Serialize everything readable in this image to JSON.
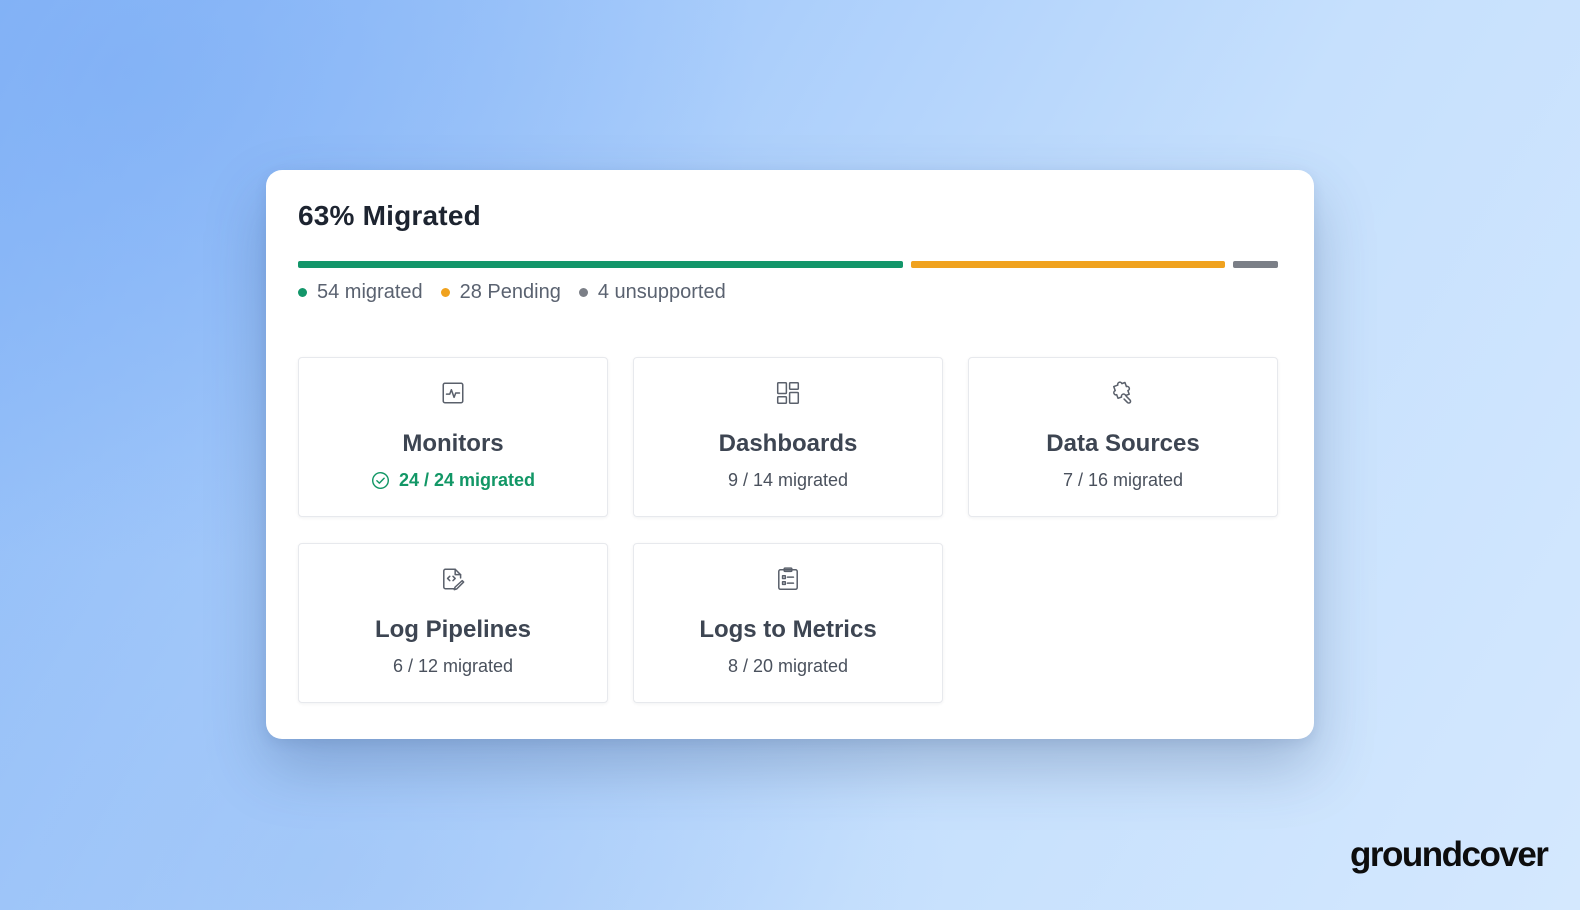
{
  "summary": {
    "title": "63% Migrated",
    "percent_migrated": 63
  },
  "progress": {
    "segments": [
      {
        "key": "migrated",
        "value": 54,
        "color": "#13966a"
      },
      {
        "key": "pending",
        "value": 28,
        "color": "#f0a21e"
      },
      {
        "key": "unsupported",
        "value": 4,
        "color": "#7b7f87"
      }
    ]
  },
  "legend": {
    "items": [
      {
        "label": "54 migrated",
        "color": "#13966a"
      },
      {
        "label": "28 Pending",
        "color": "#f0a21e"
      },
      {
        "label": "4 unsupported",
        "color": "#7b7f87"
      }
    ]
  },
  "tiles": [
    {
      "title": "Monitors",
      "status": "24 / 24 migrated",
      "icon": "monitor-pulse-icon",
      "complete": true
    },
    {
      "title": "Dashboards",
      "status": "9 / 14 migrated",
      "icon": "dashboard-layout-icon",
      "complete": false
    },
    {
      "title": "Data Sources",
      "status": "7 / 16 migrated",
      "icon": "puzzle-piece-icon",
      "complete": false
    },
    {
      "title": "Log Pipelines",
      "status": "6 / 12 migrated",
      "icon": "file-code-icon",
      "complete": false
    },
    {
      "title": "Logs to Metrics",
      "status": "8 / 20 migrated",
      "icon": "clipboard-list-icon",
      "complete": false
    }
  ],
  "colors": {
    "success": "#129766",
    "pending": "#f0a21e",
    "unsupported": "#7b7f87",
    "icon": "#5a606b"
  },
  "brand": {
    "logo": "groundcover"
  }
}
